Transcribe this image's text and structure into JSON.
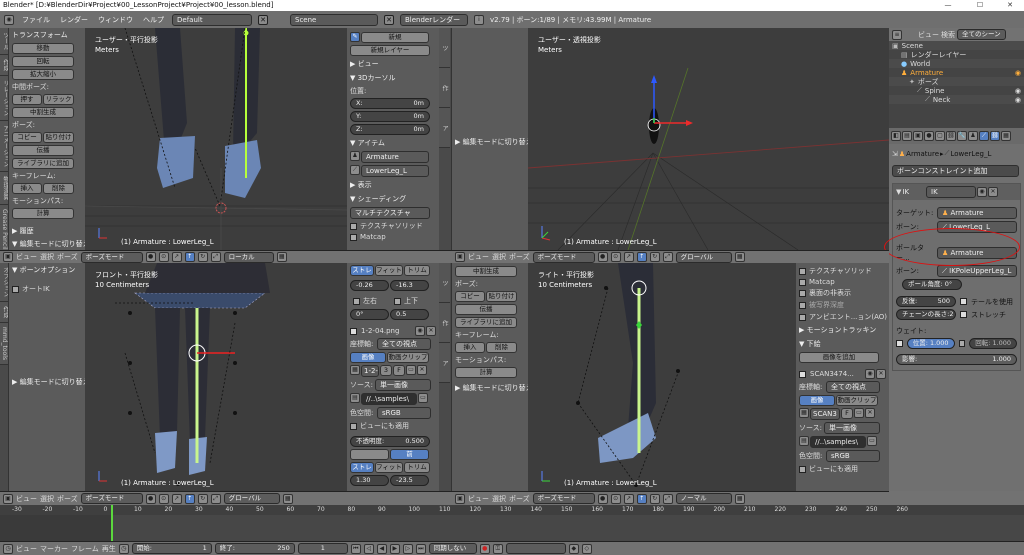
{
  "window": {
    "title": "Blender* [D:¥BlenderDir¥Project¥00_LessonProject¥Project¥00_lesson.blend]",
    "min": "—",
    "max": "☐",
    "close": "✕"
  },
  "menu": {
    "items": [
      "ファイル",
      "レンダー",
      "ウィンドウ",
      "ヘルプ"
    ],
    "layout": "Default",
    "scene": "Scene",
    "engine": "Blenderレンダー",
    "info": "v2.79 | ボーン:1/89 | メモリ:43.99M | Armature"
  },
  "tl_tool": {
    "tabs": [
      "ツール",
      "作成",
      "リレーション",
      "アニメーション",
      "物理演算",
      "Grease Pencil",
      "mmd_tools"
    ],
    "section_top": "トランスフォーム",
    "move": "移動",
    "rotate": "回転",
    "scale": "拡大縮小",
    "mid_pose": "中間ポーズ:",
    "push": "押す",
    "relax": "リラック",
    "breakdown": "中割生成",
    "pose": "ポーズ:",
    "copy": "コピー",
    "paste": "貼り付け",
    "propagate": "伝播",
    "add_lib": "ライブラリに追加",
    "keyframe": "キーフレーム:",
    "insert": "挿入",
    "delete": "削除",
    "motion_path": "モーションパス:",
    "calc": "計算",
    "history": "▶ 履歴",
    "edit_switch": "▼ 編集モードに切り替え"
  },
  "tl_view": {
    "title": "ユーザー・平行投影",
    "units": "Meters",
    "status": "(1) Armature : LowerLeg_L"
  },
  "n_panel_top": {
    "new_btn": "新規",
    "new_layer": "新規レイヤー",
    "view": "▶ ビュー",
    "cursor": "▼ 3Dカーソル",
    "location": "位置:",
    "x": "X:",
    "x_val": "0m",
    "y": "Y:",
    "y_val": "0m",
    "z": "Z:",
    "z_val": "0m",
    "item": "▼ アイテム",
    "armature": "Armature",
    "bone": "LowerLeg_L",
    "display": "▶ 表示",
    "shading": "▼ シェーディング",
    "multitex": "マルチテクスチャ",
    "tex_solid": "テクスチャソリッド",
    "matcap": "Matcap"
  },
  "tr_view": {
    "title": "ユーザー・透視投影",
    "units": "Meters",
    "status": "(1) Armature : LowerLeg_L",
    "edit_switch": "▶ 編集モードに切り替え"
  },
  "outliner": {
    "view": "ビュー",
    "search": "検索",
    "filter": "全てのシーン",
    "items": [
      "Scene",
      "レンダーレイヤー",
      "World",
      "Armature",
      "ポーズ",
      "Spine",
      "Neck"
    ]
  },
  "props": {
    "armature": "Armature",
    "bone": "LowerLeg_L",
    "add_constraint": "ボーンコンストレイント追加",
    "ik_type": "IK",
    "ik_name": "IK",
    "target_label": "ターゲット:",
    "target": "Armature",
    "bone_label": "ボーン:",
    "bone_target": "LowerLeg_L",
    "pole_label": "ポールター...",
    "pole": "Armature",
    "pole_bone_label": "ボーン:",
    "pole_bone": "IKPoleUpperLeg_L",
    "pole_angle": "ポール角度: 0°",
    "iterations_label": "反復:",
    "iterations": "500",
    "use_tail": "テールを使用",
    "chain_label": "チェーンの長さ:",
    "chain": "2",
    "stretch": "ストレッチ",
    "weight": "ウェイト:",
    "pos": "位置: 1.000",
    "rot": "回転: 1.000",
    "influence_label": "影響:",
    "influence": "1.000"
  },
  "bl_tool": {
    "tabs": [
      "オプション",
      "作成",
      "mmd_tools"
    ],
    "section": "▼ ボーンオプション",
    "auto_ik": "オートIK",
    "edit_switch": "▶ 編集モードに切り替え"
  },
  "bl_view": {
    "title": "フロント・平行投影",
    "units": "10 Centimeters",
    "status": "(1) Armature : LowerLeg_L"
  },
  "bl_npanel": {
    "stretch": "ストレ",
    "fit": "フィット",
    "trim": "トリム",
    "a": "-0.26",
    "b": "-16.3",
    "left_right": "左右",
    "up_down": "上下",
    "rot": "0°",
    "scale": "0.5",
    "image": "1-2-04.png",
    "coord_label": "座標軸:",
    "coord": "全ての視点",
    "tab_img": "画像",
    "tab_clip": "動画クリップ",
    "file_short": "1-2-",
    "frame": "3",
    "f": "F",
    "source_label": "ソース:",
    "source": "単一画像",
    "path": "//..\\samples\\",
    "colorspace_label": "色空間:",
    "colorspace": "sRGB",
    "view_use": "ビューにも適用",
    "alpha_label": "不透明度:",
    "alpha": "0.500",
    "front": "前",
    "b_stretch": "ストレ",
    "b_fit": "フィット",
    "b_trim": "トリム",
    "b_a": "1.30",
    "b_b": "-23.5"
  },
  "br_tool": {
    "breakdown": "中割生成",
    "pose": "ポーズ:",
    "copy": "コピー",
    "paste": "貼り付け",
    "propagate": "伝播",
    "add_lib": "ライブラリに追加",
    "keyframe": "キーフレーム:",
    "insert": "挿入",
    "delete": "削除",
    "motion_path": "モーションパス:",
    "calc": "計算",
    "edit_switch": "▶ 編集モードに切り替え"
  },
  "br_view": {
    "title": "ライト・平行投影",
    "units": "10 Centimeters",
    "status": "(1) Armature : LowerLeg_L"
  },
  "br_npanel": {
    "tex_solid": "テクスチャソリッド",
    "matcap": "Matcap",
    "backface": "裏面の非表示",
    "depth": "被写界深度",
    "ao": "アンビエント...ョン(AO)",
    "motion_track": "▶ モーショントラッキン",
    "background": "▼ 下絵",
    "add_image": "画像を追加",
    "scan": "SCAN3474...",
    "coord_label": "座標軸:",
    "coord": "全ての視点",
    "tab_img": "画像",
    "tab_clip": "動画クリップ",
    "scan_short": "SCAN3",
    "f": "F",
    "source_label": "ソース:",
    "source": "単一画像",
    "path": "//..\\samples\\",
    "colorspace_label": "色空間:",
    "colorspace": "sRGB",
    "view_use": "ビューにも適用"
  },
  "headers": {
    "view": "ビュー",
    "select": "選択",
    "pose": "ポーズ",
    "mode": "ポーズモード",
    "local": "ローカル",
    "global": "グローバル",
    "normal": "ノーマル"
  },
  "timeline": {
    "ticks": [
      "-30",
      "-20",
      "-10",
      "0",
      "10",
      "20",
      "30",
      "40",
      "50",
      "60",
      "70",
      "80",
      "90",
      "100",
      "110",
      "120",
      "130",
      "140",
      "150",
      "160",
      "170",
      "180",
      "190",
      "200",
      "210",
      "220",
      "230",
      "240",
      "250",
      "260"
    ],
    "view": "ビュー",
    "marker": "マーカー",
    "frame": "フレーム",
    "play": "再生",
    "start_label": "開始:",
    "start": "1",
    "end_label": "終了:",
    "end": "250",
    "current": "1",
    "sync": "同期しない"
  }
}
